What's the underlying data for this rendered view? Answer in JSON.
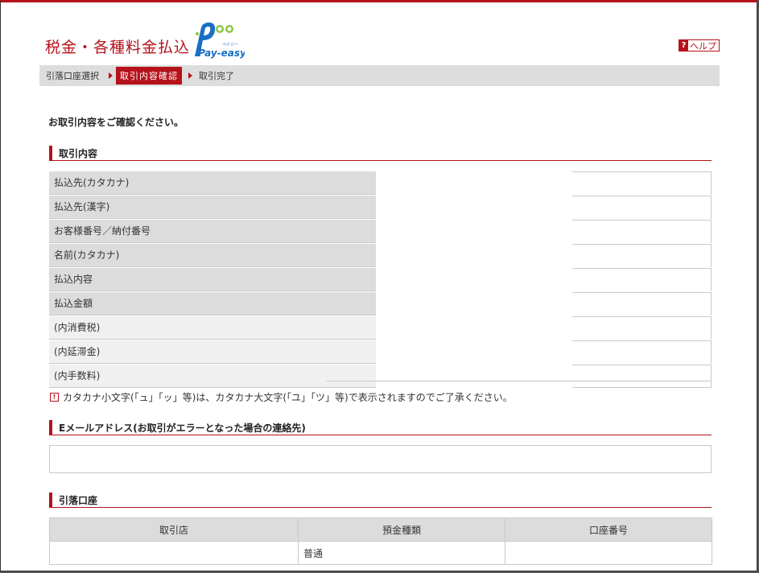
{
  "header": {
    "title": "税金・各種料金払込",
    "logo_text": "Pay-easy",
    "logo_ruby": "ペイジー",
    "help_icon": "?",
    "help_label": "ヘルプ"
  },
  "breadcrumb": [
    {
      "label": "引落口座選択",
      "active": false
    },
    {
      "label": "取引内容確認",
      "active": true
    },
    {
      "label": "取引完了",
      "active": false
    }
  ],
  "intro": "お取引内容をご確認ください。",
  "transaction_section": {
    "heading": "取引内容",
    "rows": [
      {
        "label": "払込先(カタカナ)",
        "value": ""
      },
      {
        "label": "払込先(漢字)",
        "value": ""
      },
      {
        "label": "お客様番号／納付番号",
        "value": ""
      },
      {
        "label": "名前(カタカナ)",
        "value": ""
      },
      {
        "label": "払込内容",
        "value": ""
      },
      {
        "label": "払込金額",
        "value": ""
      },
      {
        "label": "(内消費税)",
        "value": ""
      },
      {
        "label": "(内延滞金)",
        "value": ""
      },
      {
        "label": "(内手数料)",
        "value": ""
      }
    ],
    "note": "カタカナ小文字(「ュ」「ッ」等)は、カタカナ大文字(「ユ」「ツ」等)で表示されますのでご了承ください。"
  },
  "email_section": {
    "heading": "Eメールアドレス(お取引がエラーとなった場合の連絡先)",
    "value": ""
  },
  "account_section": {
    "heading": "引落口座",
    "columns": [
      "取引店",
      "預金種類",
      "口座番号"
    ],
    "rows": [
      {
        "branch": "",
        "type": "普通",
        "number": ""
      }
    ]
  },
  "colors": {
    "accent": "#b5121b",
    "header_bg": "#dcdcdc",
    "light_bg": "#f0f0f0",
    "breadcrumb_bg": "#dddddd"
  }
}
